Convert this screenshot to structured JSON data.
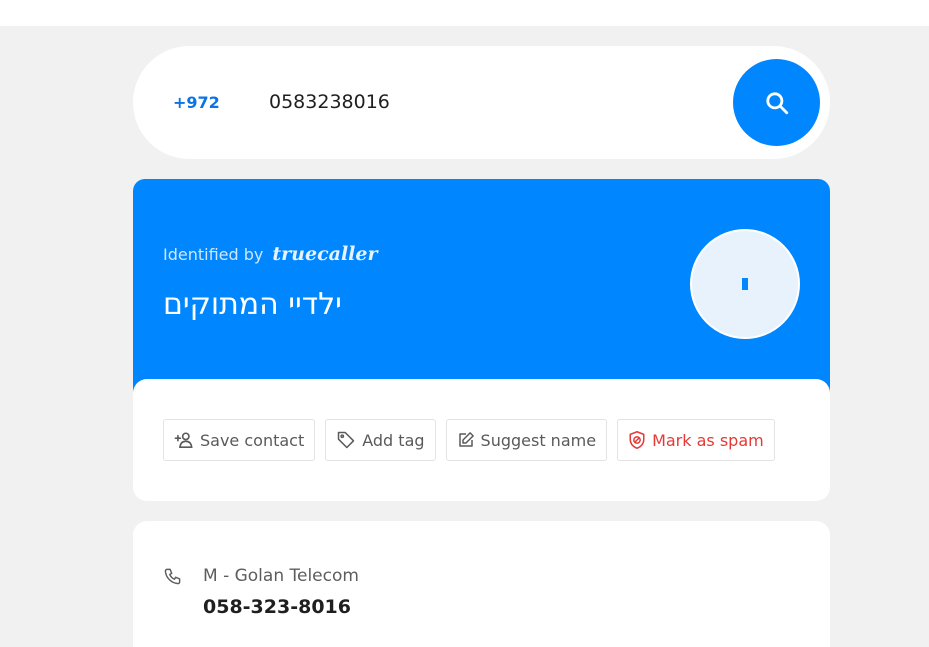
{
  "search": {
    "country_code": "+972",
    "phone_value": "0583238016",
    "search_icon": "search-icon"
  },
  "result": {
    "identified_by": "Identified by",
    "brand": "truecaller",
    "name": "ילדיי המתוקים",
    "avatar_icon": "avatar-placeholder"
  },
  "actions": [
    {
      "label": "Save contact",
      "icon": "add-person-icon"
    },
    {
      "label": "Add tag",
      "icon": "tag-icon"
    },
    {
      "label": "Suggest name",
      "icon": "edit-icon"
    },
    {
      "label": "Mark as spam",
      "icon": "shield-spam-icon"
    }
  ],
  "details": {
    "phone_icon": "phone-icon",
    "carrier": "M - Golan Telecom",
    "number": "058-323-8016"
  },
  "colors": {
    "accent": "#0087ff",
    "country_code": "#0b74e5",
    "spam": "#e53935",
    "background": "#f1f1f1"
  }
}
